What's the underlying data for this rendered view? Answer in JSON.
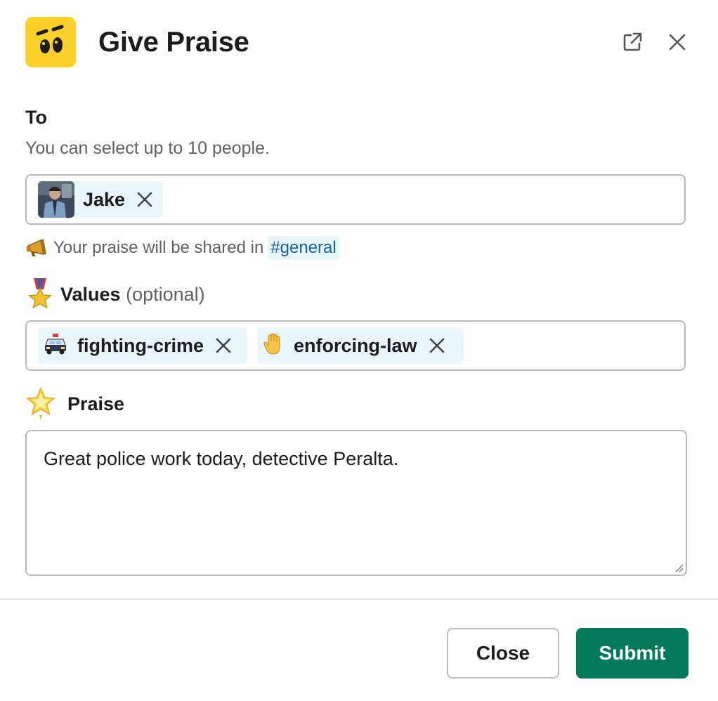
{
  "header": {
    "title": "Give Praise",
    "popout_icon": "external-link-icon",
    "close_icon": "close-icon",
    "app_icon": "praise-app-face-icon",
    "app_icon_color": "#fcd02b"
  },
  "to_field": {
    "label": "To",
    "hint": "You can select up to 10 people.",
    "selected": [
      {
        "name": "Jake",
        "avatar": "user-avatar"
      }
    ]
  },
  "share_note": {
    "icon": "megaphone-icon",
    "text": "Your praise will be shared in",
    "channel": "#general"
  },
  "values_field": {
    "icon": "military-medal-icon",
    "label": "Values",
    "optional": "(optional)",
    "selected": [
      {
        "emoji": "police-car-icon",
        "label": "fighting-crime"
      },
      {
        "emoji": "raised-hand-icon",
        "label": "enforcing-law"
      }
    ]
  },
  "praise_field": {
    "icon": "glowing-star-icon",
    "label": "Praise",
    "value": "Great police work today, detective Peralta."
  },
  "footer": {
    "close_label": "Close",
    "submit_label": "Submit",
    "submit_color": "#007a5a"
  },
  "colors": {
    "chip_bg": "#e8f5fa",
    "link": "#1264a3",
    "muted_text": "#616061"
  }
}
